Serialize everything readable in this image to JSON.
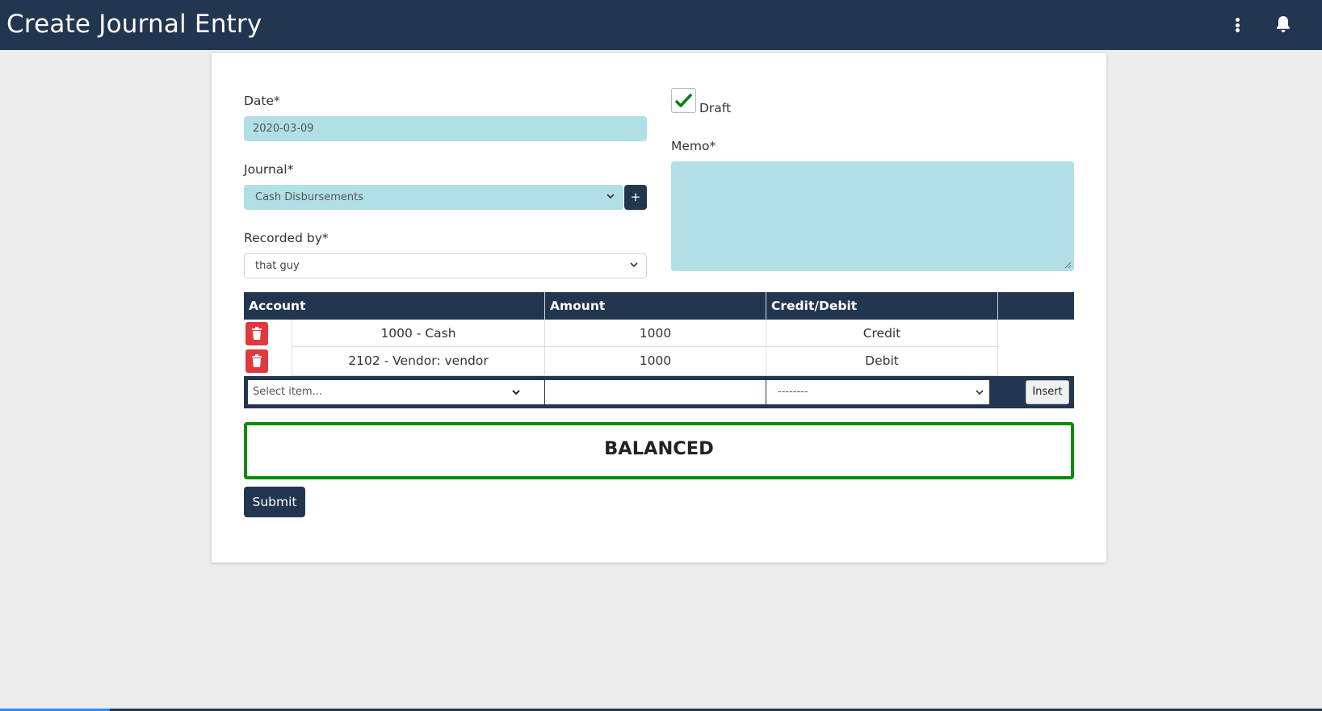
{
  "header": {
    "title": "Create Journal Entry",
    "menu_icon": "kebab-menu-icon",
    "bell_icon": "bell-icon"
  },
  "form": {
    "date": {
      "label": "Date*",
      "value": "2020-03-09"
    },
    "journal": {
      "label": "Journal*",
      "value": "Cash Disbursements",
      "add_label": "+"
    },
    "recorded_by": {
      "label": "Recorded by*",
      "value": "that guy"
    },
    "draft": {
      "label": "Draft",
      "checked": true
    },
    "memo": {
      "label": "Memo*",
      "value": ""
    }
  },
  "lines": {
    "headers": [
      "Account",
      "Amount",
      "Credit/Debit"
    ],
    "rows": [
      {
        "account": "1000 - Cash",
        "amount": "1000",
        "type": "Credit"
      },
      {
        "account": "2102 - Vendor: vendor",
        "amount": "1000",
        "type": "Debit"
      }
    ],
    "new_line": {
      "account_placeholder": "Select item...",
      "amount": "",
      "type": "--------",
      "insert_label": "Insert"
    }
  },
  "status": {
    "text": "BALANCED",
    "color": "#098b09"
  },
  "submit_label": "Submit",
  "colors": {
    "navy": "#223650",
    "teal_field": "#b0dfe5",
    "delete_red": "#e0383e"
  }
}
